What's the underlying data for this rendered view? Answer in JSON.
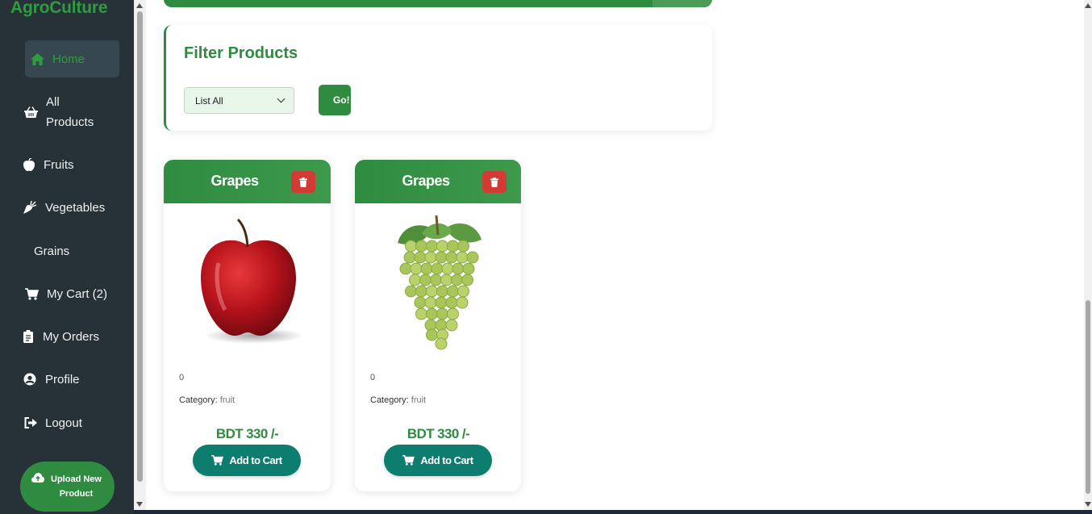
{
  "brand": "AgroCulture",
  "sidebar": {
    "items": [
      {
        "label": "Home",
        "icon": "home-icon"
      },
      {
        "label": "All Products",
        "icon": "basket-icon"
      },
      {
        "label": "Fruits",
        "icon": "apple-icon"
      },
      {
        "label": "Vegetables",
        "icon": "carrot-icon"
      },
      {
        "label": "Grains",
        "icon": ""
      },
      {
        "label": "My Cart (2)",
        "icon": "cart-icon"
      },
      {
        "label": "My Orders",
        "icon": "clipboard-icon"
      },
      {
        "label": "Profile",
        "icon": "user-circle-icon"
      },
      {
        "label": "Logout",
        "icon": "logout-icon"
      }
    ],
    "upload_label": "Upload New Product"
  },
  "filter": {
    "title": "Filter Products",
    "selected": "List All",
    "go_label": "Go!"
  },
  "products": [
    {
      "name": "Grapes",
      "quantity": "0",
      "category_label": "Category:",
      "category": "fruit",
      "price": "BDT 330 /-",
      "cart_label": "Add to Cart",
      "image": "red-apple"
    },
    {
      "name": "Grapes",
      "quantity": "0",
      "category_label": "Category:",
      "category": "fruit",
      "price": "BDT 330 /-",
      "cart_label": "Add to Cart",
      "image": "green-grapes"
    }
  ],
  "colors": {
    "primary": "#2e8b40",
    "sidebar": "#263238",
    "danger": "#d23a35",
    "cart": "#0c7d6e"
  }
}
